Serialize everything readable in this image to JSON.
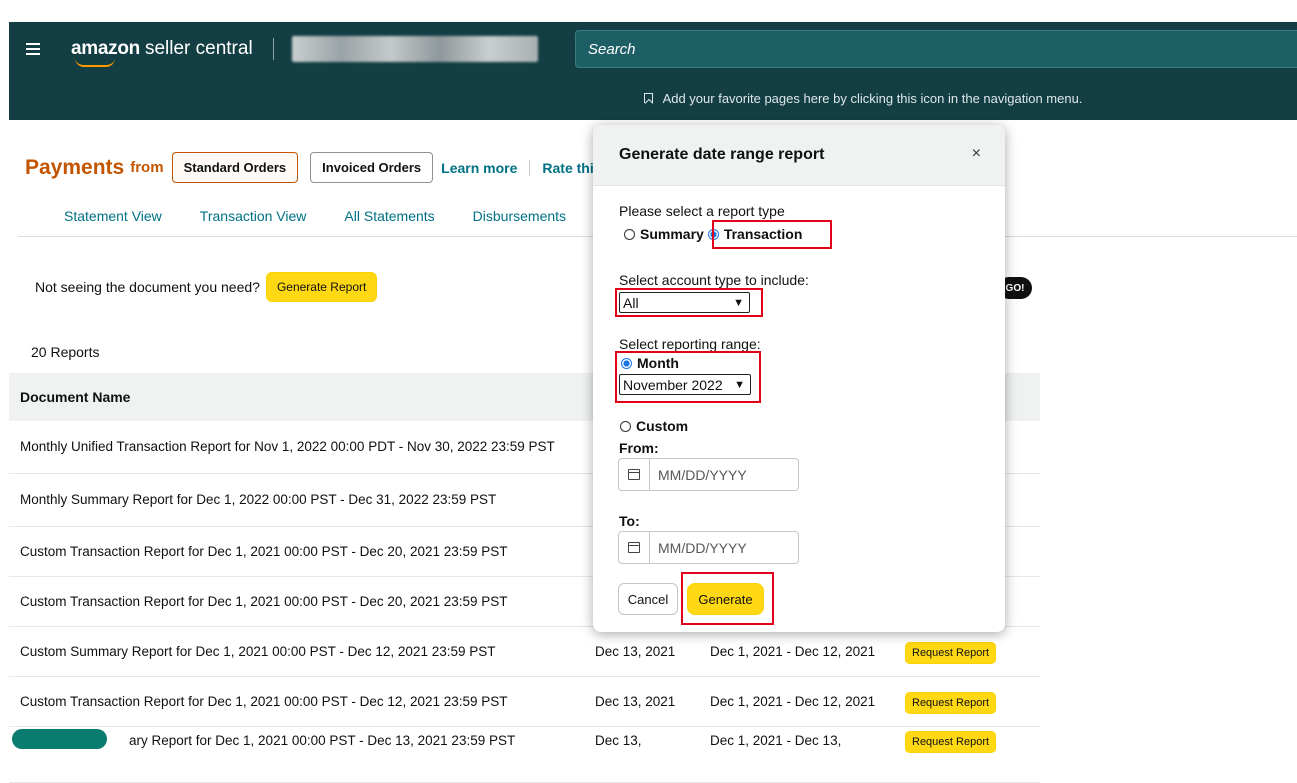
{
  "header": {
    "logo_brand": "amazon",
    "logo_product": "seller central",
    "search_placeholder": "Search",
    "favorites_hint": "Add your favorite pages here by clicking this icon in the navigation menu."
  },
  "payments": {
    "title": "Payments",
    "from": "from",
    "tabs": [
      "Standard Orders",
      "Invoiced Orders"
    ],
    "learn_more": "Learn more",
    "rate": "Rate this",
    "subtabs": [
      "Statement View",
      "Transaction View",
      "All Statements",
      "Disbursements"
    ]
  },
  "reports": {
    "not_seeing": "Not seeing the document you need?",
    "generate_report_btn": "Generate Report",
    "go_label": "GO!",
    "count": "20 Reports",
    "column_document_name": "Document Name",
    "rows": [
      {
        "name": "Monthly Unified Transaction Report for Nov 1, 2022 00:00 PDT - Nov 30, 2022 23:59 PST",
        "date": "",
        "range": "",
        "action": ""
      },
      {
        "name": "Monthly Summary Report for Dec 1, 2022 00:00 PST - Dec 31, 2022 23:59 PST",
        "date": "",
        "range": "",
        "action": ""
      },
      {
        "name": "Custom Transaction Report for Dec 1, 2021 00:00 PST - Dec 20, 2021 23:59 PST",
        "date": "",
        "range": "",
        "action": ""
      },
      {
        "name": "Custom Transaction Report for Dec 1, 2021 00:00 PST - Dec 20, 2021 23:59 PST",
        "date": "",
        "range": "",
        "action": ""
      },
      {
        "name": "Custom Summary Report for Dec 1, 2021 00:00 PST - Dec 12, 2021 23:59 PST",
        "date": "Dec 13, 2021",
        "range": "Dec 1, 2021 - Dec 12, 2021",
        "action": "Request Report"
      },
      {
        "name": "Custom Transaction Report for Dec 1, 2021 00:00 PST - Dec 12, 2021 23:59 PST",
        "date": "Dec 13, 2021",
        "range": "Dec 1, 2021 - Dec 12, 2021",
        "action": "Request Report"
      },
      {
        "name": "ary Report for Dec 1, 2021 00:00 PST - Dec 13, 2021 23:59 PST",
        "date": "Dec 13,",
        "range": "Dec 1, 2021 - Dec 13,",
        "action": "Request Report"
      }
    ]
  },
  "modal": {
    "title": "Generate date range report",
    "close": "×",
    "report_type_label": "Please select a report type",
    "type_summary": "Summary",
    "type_transaction": "Transaction",
    "account_type_label": "Select account type to include:",
    "account_type_value": "All",
    "range_label": "Select reporting range:",
    "month_label": "Month",
    "month_value": "November 2022",
    "custom_label": "Custom",
    "from_label": "From:",
    "to_label": "To:",
    "date_placeholder": "MM/DD/YYYY",
    "cancel": "Cancel",
    "generate": "Generate"
  }
}
